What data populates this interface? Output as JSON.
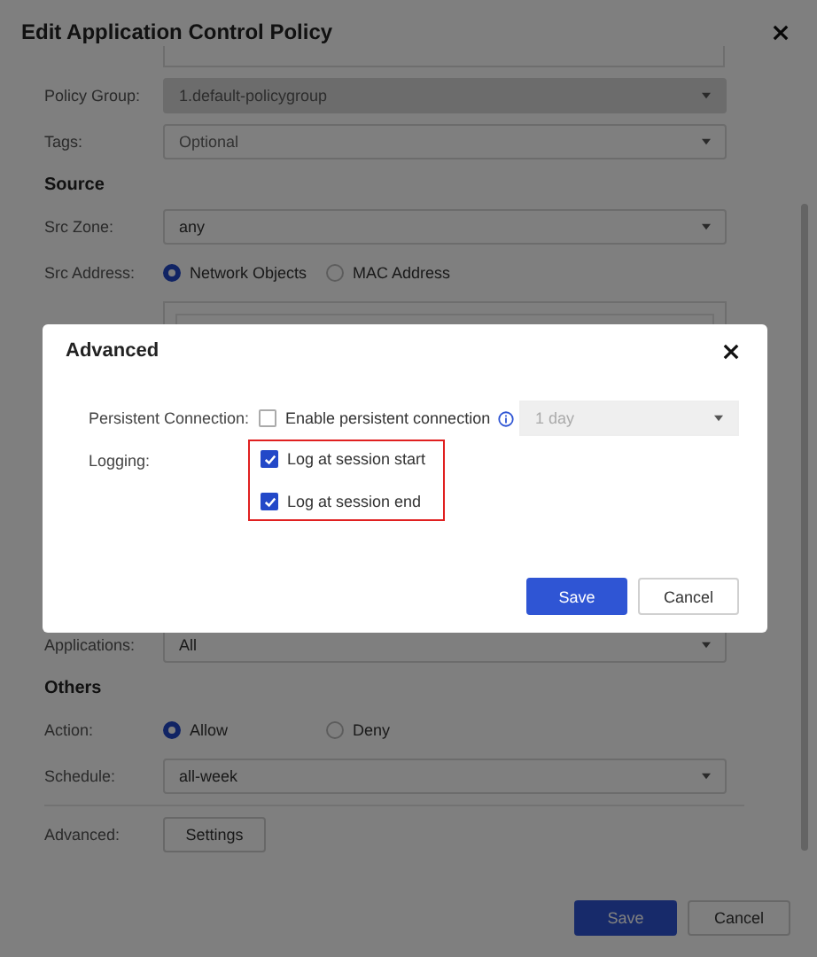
{
  "dialog": {
    "title": "Edit Application Control Policy",
    "rows": [
      {
        "kind": "select",
        "label": "Policy Group:",
        "value": "1.default-policygroup",
        "disabled": true
      },
      {
        "kind": "select",
        "label": "Tags:",
        "placeholder": "Optional",
        "disabled": false
      },
      {
        "kind": "section",
        "title": "Source"
      },
      {
        "kind": "select",
        "label": "Src Zone:",
        "value": "any",
        "disabled": false
      },
      {
        "kind": "radio",
        "label": "Src Address:",
        "options": [
          {
            "label": "Network Objects",
            "selected": true
          },
          {
            "label": "MAC Address",
            "selected": false
          }
        ]
      },
      {
        "kind": "listbox"
      },
      {
        "kind": "select",
        "label": "Applications:",
        "value": "All",
        "disabled": false
      },
      {
        "kind": "section",
        "title": "Others"
      },
      {
        "kind": "radio",
        "label": "Action:",
        "options": [
          {
            "label": "Allow",
            "selected": true
          },
          {
            "label": "Deny",
            "selected": false
          }
        ]
      },
      {
        "kind": "select",
        "label": "Schedule:",
        "value": "all-week",
        "disabled": false
      },
      {
        "kind": "button",
        "label": "Advanced:",
        "button": "Settings"
      }
    ],
    "buttons": [
      {
        "label": "Save",
        "kind": "primary"
      },
      {
        "label": "Cancel",
        "kind": "secondary"
      }
    ]
  },
  "advanced": {
    "title": "Advanced",
    "persistent": {
      "label": "Persistent Connection:",
      "option": "Enable persistent connection",
      "checked": false,
      "duration": "1 day",
      "duration_disabled": true
    },
    "logging": {
      "label": "Logging:",
      "highlighted": true,
      "options": [
        {
          "label": "Log at session start",
          "checked": true
        },
        {
          "label": "Log at session end",
          "checked": true
        }
      ]
    },
    "buttons": [
      {
        "label": "Save",
        "kind": "primary"
      },
      {
        "label": "Cancel",
        "kind": "secondary"
      }
    ]
  }
}
